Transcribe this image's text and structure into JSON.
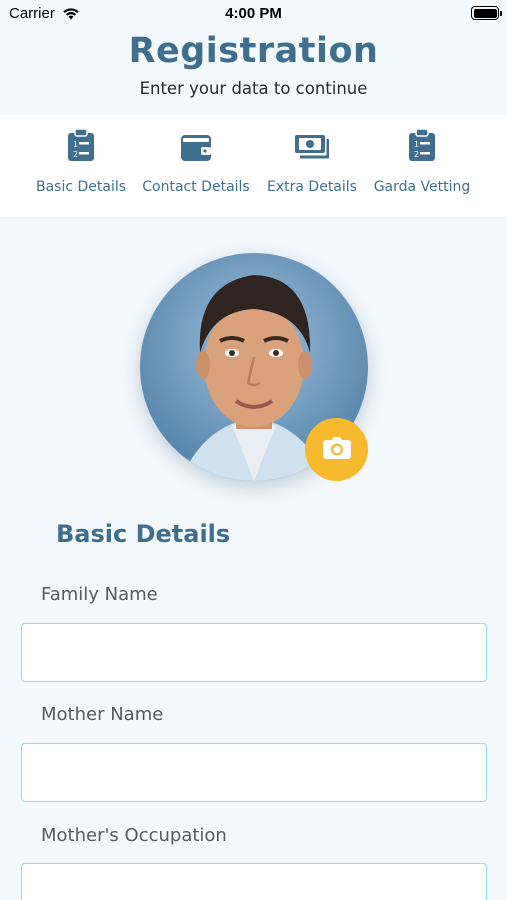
{
  "status_bar": {
    "carrier": "Carrier",
    "time": "4:00 PM"
  },
  "header": {
    "title": "Registration",
    "subtitle": "Enter your data to continue"
  },
  "steps": [
    {
      "label": "Basic Details",
      "icon": "clipboard-list-icon"
    },
    {
      "label": "Contact Details",
      "icon": "wallet-icon"
    },
    {
      "label": "Extra Details",
      "icon": "money-bill-icon"
    },
    {
      "label": "Garda Vetting",
      "icon": "clipboard-list-icon"
    }
  ],
  "profile": {
    "photo": "profile-photo",
    "camera_icon": "camera-icon"
  },
  "form": {
    "section_title": "Basic Details",
    "fields": [
      {
        "label": "Family Name",
        "value": "",
        "placeholder": ""
      },
      {
        "label": "Mother Name",
        "value": "",
        "placeholder": ""
      },
      {
        "label": "Mother's Occupation",
        "value": "",
        "placeholder": ""
      }
    ]
  },
  "colors": {
    "accent": "#3f6e8f",
    "background": "#f2f8fc",
    "camera_button": "#f7b92d",
    "input_border": "#8fdcec"
  }
}
